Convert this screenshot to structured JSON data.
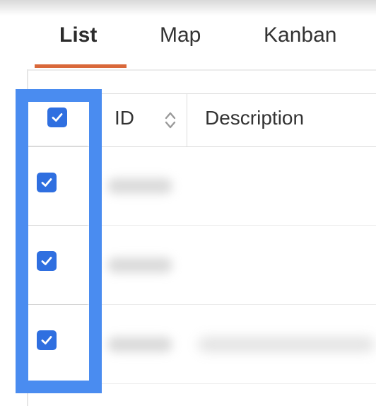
{
  "tabs": [
    {
      "label": "List",
      "active": true
    },
    {
      "label": "Map",
      "active": false
    },
    {
      "label": "Kanban",
      "active": false
    }
  ],
  "table": {
    "columns": [
      "ID",
      "Description"
    ],
    "select_all_checked": true,
    "rows": [
      {
        "checked": true,
        "id": "",
        "description": ""
      },
      {
        "checked": true,
        "id": "",
        "description": ""
      },
      {
        "checked": true,
        "id": "",
        "description": ""
      }
    ]
  },
  "colors": {
    "accent_underline": "#d9683a",
    "highlight": "#4a8cf0",
    "checkbox": "#2f6fe0"
  },
  "icons": [
    "sort-icon",
    "checkmark-icon"
  ]
}
